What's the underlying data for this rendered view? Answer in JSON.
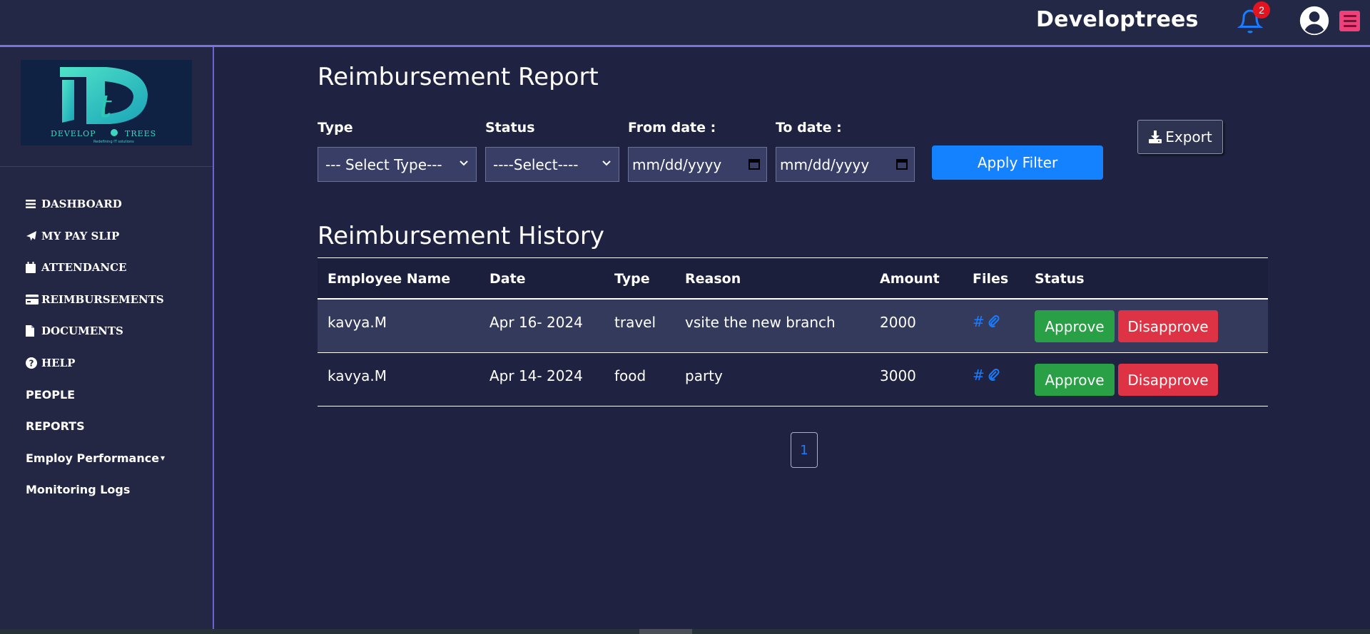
{
  "header": {
    "brand": "Developtrees",
    "notification_count": "2"
  },
  "sidebar": {
    "logo_text": "DEVELOPTREES",
    "items": [
      {
        "label": "DASHBOARD",
        "icon": "bars-icon"
      },
      {
        "label": "MY PAY SLIP",
        "icon": "paper-plane-icon"
      },
      {
        "label": "ATTENDANCE",
        "icon": "calendar-icon"
      },
      {
        "label": "REIMBURSEMENTS",
        "icon": "credit-card-icon"
      },
      {
        "label": "DOCUMENTS",
        "icon": "file-icon"
      },
      {
        "label": "HELP",
        "icon": "question-circle-icon"
      },
      {
        "label": "PEOPLE"
      },
      {
        "label": "REPORTS"
      },
      {
        "label": "Employ Performance"
      },
      {
        "label": "Monitoring Logs"
      }
    ]
  },
  "report": {
    "title": "Reimbursement Report",
    "filters": {
      "type_label": "Type",
      "type_value": "--- Select Type---",
      "status_label": "Status",
      "status_value": "----Select----",
      "from_label": "From date :",
      "from_placeholder": "mm/dd/yyyy",
      "to_label": "To date :",
      "to_placeholder": "mm/dd/yyyy",
      "apply_label": "Apply Filter",
      "export_label": "Export"
    }
  },
  "history": {
    "title": "Reimbursement History",
    "columns": [
      "Employee Name",
      "Date",
      "Type",
      "Reason",
      "Amount",
      "Files",
      "Status"
    ],
    "rows": [
      {
        "employee": "kavya.M",
        "date": "Apr 16- 2024",
        "type": "travel",
        "reason": "vsite the new branch",
        "amount": "2000",
        "files": "#"
      },
      {
        "employee": "kavya.M",
        "date": "Apr 14- 2024",
        "type": "food",
        "reason": "party",
        "amount": "3000",
        "files": "#"
      }
    ],
    "approve_label": "Approve",
    "disapprove_label": "Disapprove",
    "page": "1"
  },
  "colors": {
    "background": "#1f2341",
    "accent_blue": "#1481ff",
    "approve_green": "#2aa046",
    "disapprove_red": "#dd3344",
    "badge_red": "#e3141f",
    "menu_pink": "#f0407a"
  }
}
